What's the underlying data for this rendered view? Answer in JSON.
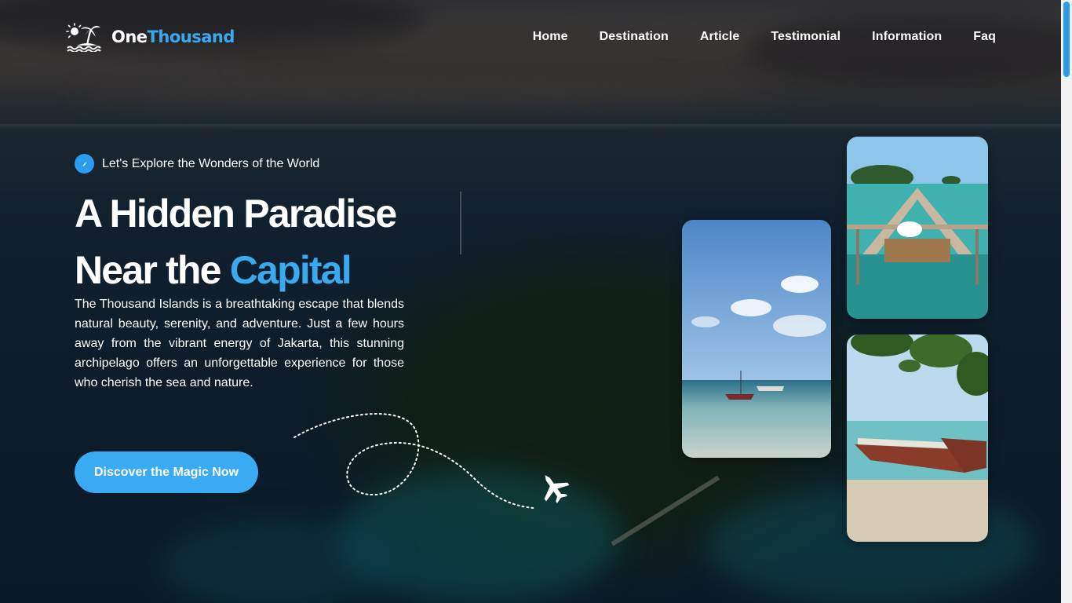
{
  "brand": {
    "name_part1": "One",
    "name_part2": "Thousand",
    "logo_icon": "island-palm-icon"
  },
  "nav": {
    "items": [
      "Home",
      "Destination",
      "Article",
      "Testimonial",
      "Information",
      "Faq"
    ]
  },
  "hero": {
    "tagline": "Let's Explore the Wonders of the World",
    "tagline_icon": "compass-icon",
    "title_line1": "A Hidden Paradise",
    "title_line2_plain": "Near the",
    "title_line2_highlight": "Capital",
    "description": "The Thousand Islands is a breathtaking escape that blends natural beauty, serenity, and adventure. Just a few hours away from the vibrant energy of Jakarta, this stunning archipelago offers an unforgettable experience for those who cherish the sea and nature.",
    "cta_label": "Discover the Magic Now",
    "decor_icon": "airplane-icon"
  },
  "gallery": {
    "photos": [
      "beach-boats-photo",
      "island-pier-photo",
      "moored-boats-photo"
    ]
  },
  "colors": {
    "accent": "#3aaaf0",
    "button": "#3aabf2",
    "text": "#ffffff"
  }
}
